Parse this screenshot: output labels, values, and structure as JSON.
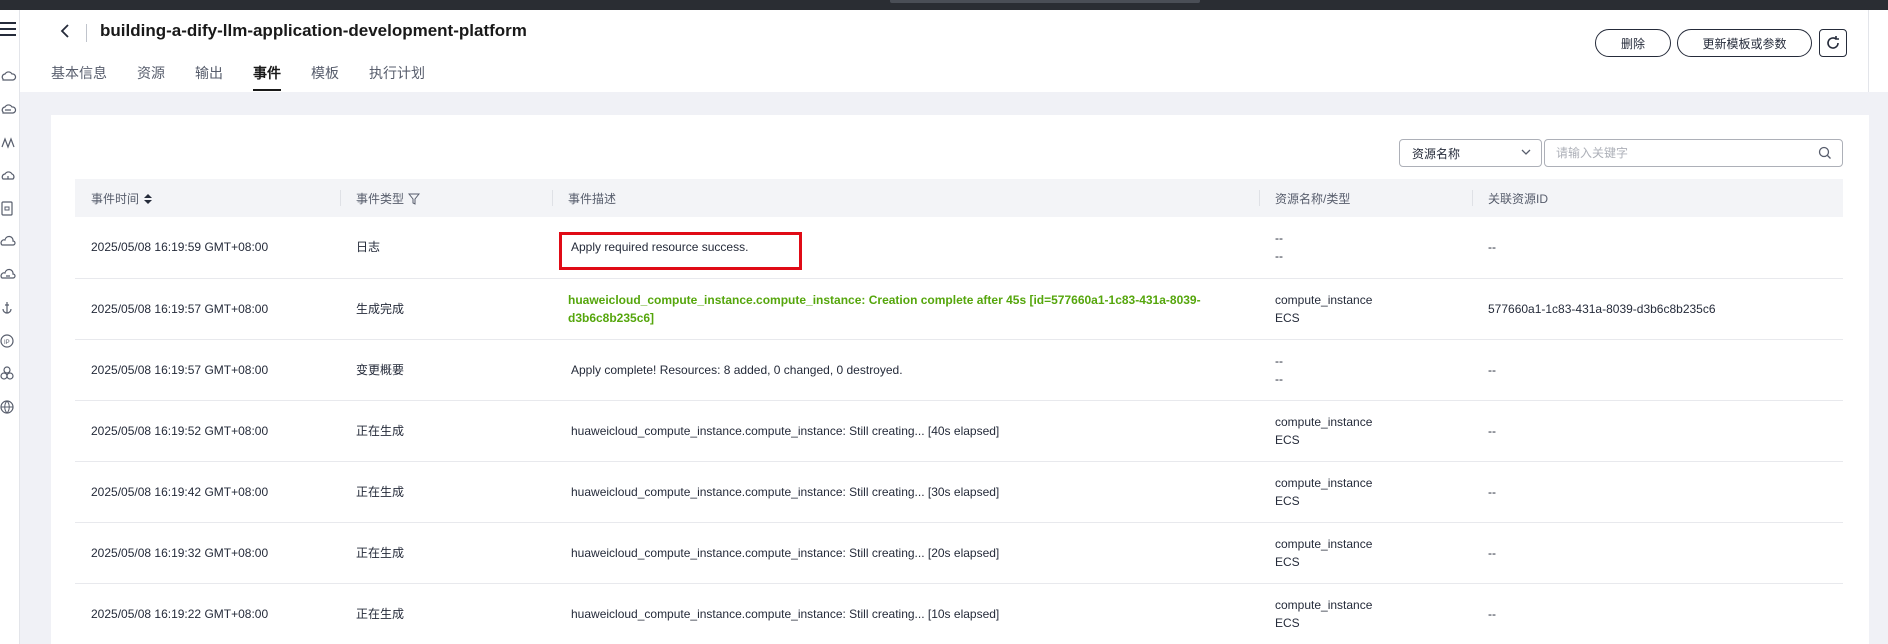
{
  "header": {
    "title": "building-a-dify-llm-application-development-platform",
    "tabs": [
      "基本信息",
      "资源",
      "输出",
      "事件",
      "模板",
      "执行计划"
    ],
    "active_tab": 3,
    "delete_label": "删除",
    "update_label": "更新模板或参数"
  },
  "filter": {
    "select_value": "资源名称",
    "search_placeholder": "请输入关键字"
  },
  "table": {
    "columns": [
      "事件时间",
      "事件类型",
      "事件描述",
      "资源名称/类型",
      "关联资源ID"
    ],
    "rows": [
      {
        "time": "2025/05/08 16:19:59 GMT+08:00",
        "type": "日志",
        "desc": "Apply required resource success.",
        "res_name": "--",
        "res_type": "--",
        "res_id": "--"
      },
      {
        "time": "2025/05/08 16:19:57 GMT+08:00",
        "type": "生成完成",
        "desc": "huaweicloud_compute_instance.compute_instance: Creation complete after 45s [id=577660a1-1c83-431a-8039-d3b6c8b235c6]",
        "res_name": "compute_instance",
        "res_type": "ECS",
        "res_id": "577660a1-1c83-431a-8039-d3b6c8b235c6"
      },
      {
        "time": "2025/05/08 16:19:57 GMT+08:00",
        "type": "变更概要",
        "desc": "Apply complete! Resources: 8 added, 0 changed, 0 destroyed.",
        "res_name": "--",
        "res_type": "--",
        "res_id": "--"
      },
      {
        "time": "2025/05/08 16:19:52 GMT+08:00",
        "type": "正在生成",
        "desc": "huaweicloud_compute_instance.compute_instance: Still creating... [40s elapsed]",
        "res_name": "compute_instance",
        "res_type": "ECS",
        "res_id": "--"
      },
      {
        "time": "2025/05/08 16:19:42 GMT+08:00",
        "type": "正在生成",
        "desc": "huaweicloud_compute_instance.compute_instance: Still creating... [30s elapsed]",
        "res_name": "compute_instance",
        "res_type": "ECS",
        "res_id": "--"
      },
      {
        "time": "2025/05/08 16:19:32 GMT+08:00",
        "type": "正在生成",
        "desc": "huaweicloud_compute_instance.compute_instance: Still creating... [20s elapsed]",
        "res_name": "compute_instance",
        "res_type": "ECS",
        "res_id": "--"
      },
      {
        "time": "2025/05/08 16:19:22 GMT+08:00",
        "type": "正在生成",
        "desc": "huaweicloud_compute_instance.compute_instance: Still creating... [10s elapsed]",
        "res_name": "compute_instance",
        "res_type": "ECS",
        "res_id": "--"
      }
    ]
  },
  "colors": {
    "success_green": "#55a60c",
    "highlight_red": "#e00b16"
  }
}
